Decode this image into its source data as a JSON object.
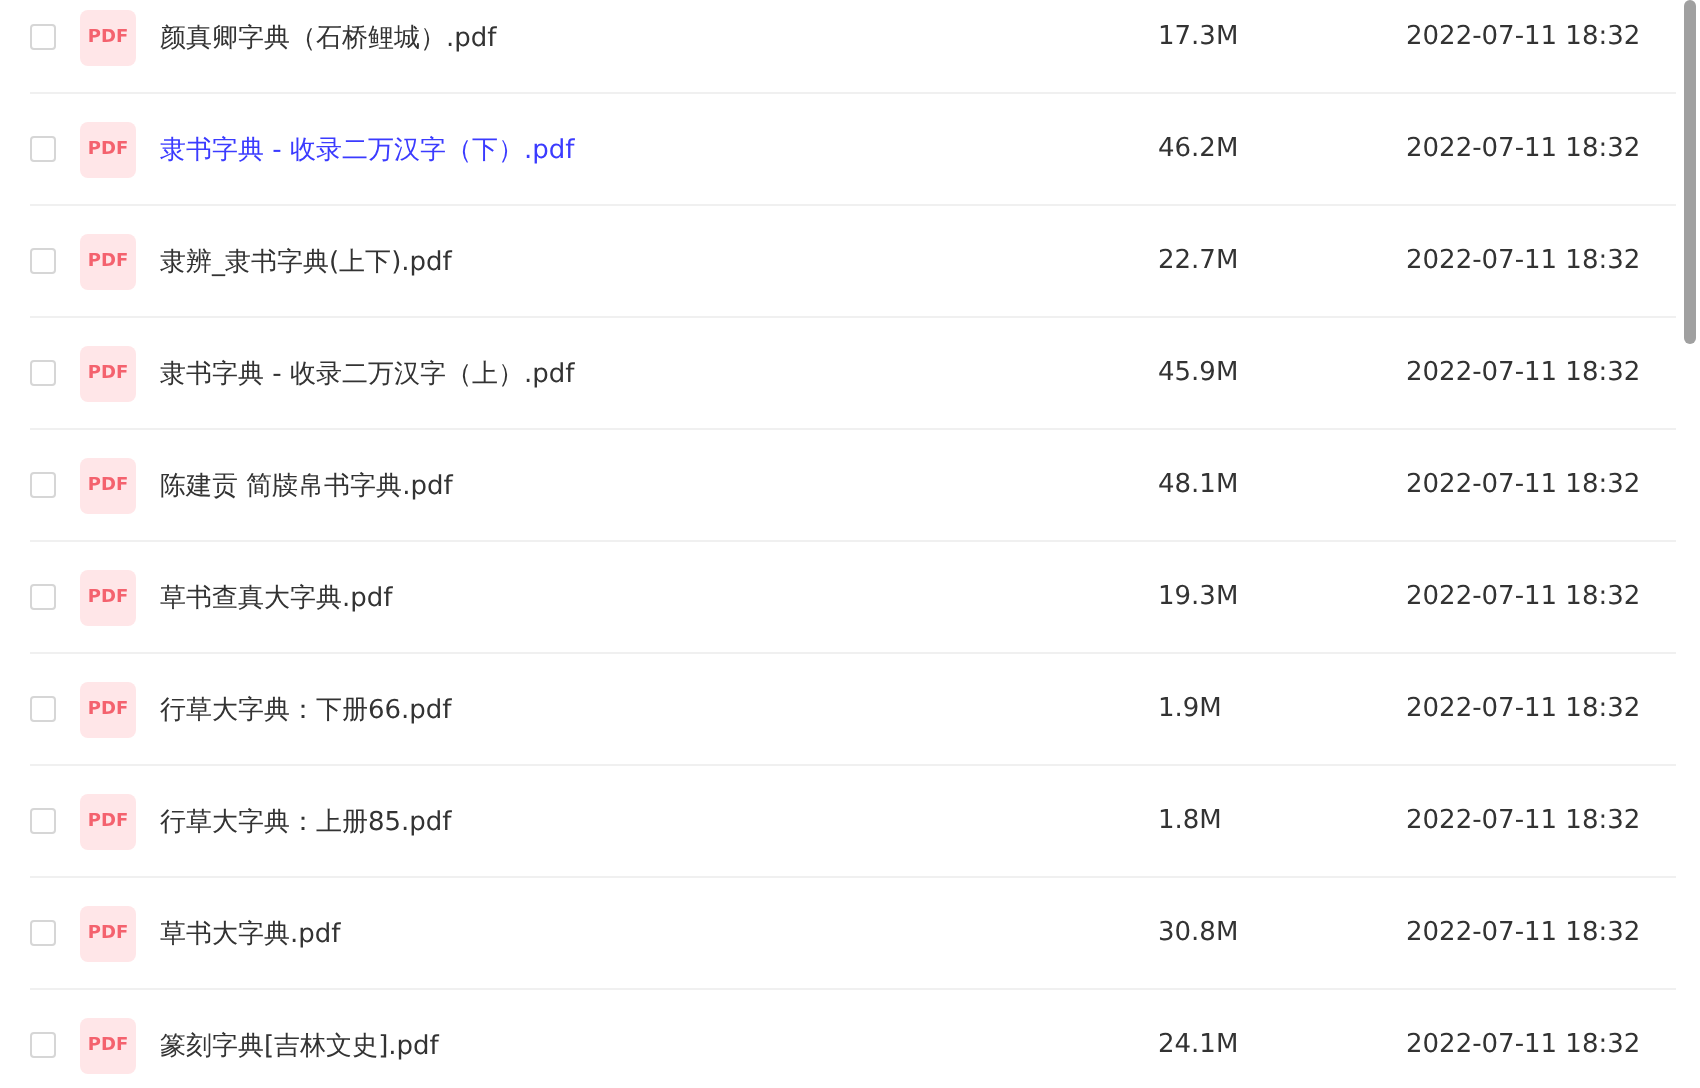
{
  "files": [
    {
      "name": "颜真卿字典（石桥鲤城）.pdf",
      "badge": "PDF",
      "size": "17.3M",
      "modified": "2022-07-11 18:32",
      "checked": false,
      "hovered": false
    },
    {
      "name": "隶书字典 - 收录二万汉字（下）.pdf",
      "badge": "PDF",
      "size": "46.2M",
      "modified": "2022-07-11 18:32",
      "checked": false,
      "hovered": true
    },
    {
      "name": "隶辨_隶书字典(上下).pdf",
      "badge": "PDF",
      "size": "22.7M",
      "modified": "2022-07-11 18:32",
      "checked": false,
      "hovered": false
    },
    {
      "name": "隶书字典 - 收录二万汉字（上）.pdf",
      "badge": "PDF",
      "size": "45.9M",
      "modified": "2022-07-11 18:32",
      "checked": false,
      "hovered": false
    },
    {
      "name": "陈建贡 简牍帛书字典.pdf",
      "badge": "PDF",
      "size": "48.1M",
      "modified": "2022-07-11 18:32",
      "checked": false,
      "hovered": false
    },
    {
      "name": "草书查真大字典.pdf",
      "badge": "PDF",
      "size": "19.3M",
      "modified": "2022-07-11 18:32",
      "checked": false,
      "hovered": false
    },
    {
      "name": "行草大字典：下册66.pdf",
      "badge": "PDF",
      "size": "1.9M",
      "modified": "2022-07-11 18:32",
      "checked": false,
      "hovered": false
    },
    {
      "name": "行草大字典：上册85.pdf",
      "badge": "PDF",
      "size": "1.8M",
      "modified": "2022-07-11 18:32",
      "checked": false,
      "hovered": false
    },
    {
      "name": "草书大字典.pdf",
      "badge": "PDF",
      "size": "30.8M",
      "modified": "2022-07-11 18:32",
      "checked": false,
      "hovered": false
    },
    {
      "name": "篆刻字典[吉林文史].pdf",
      "badge": "PDF",
      "size": "24.1M",
      "modified": "2022-07-11 18:32",
      "checked": false,
      "hovered": false
    }
  ]
}
